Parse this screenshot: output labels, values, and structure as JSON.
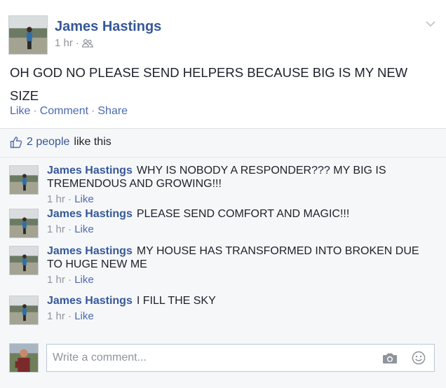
{
  "post": {
    "author": "James Hastings",
    "time": "1 hr",
    "audience_icon": "friends-icon",
    "text": "OH GOD NO PLEASE SEND HELPERS BECAUSE BIG IS MY NEW SIZE",
    "actions": {
      "like": "Like",
      "comment": "Comment",
      "share": "Share"
    }
  },
  "likes": {
    "count": "2 people",
    "suffix": "like this"
  },
  "comments": [
    {
      "author": "James Hastings",
      "text": "WHY IS NOBODY A RESPONDER??? MY BIG IS TREMENDOUS AND GROWING!!!",
      "time": "1 hr",
      "like": "Like"
    },
    {
      "author": "James Hastings",
      "text": "PLEASE SEND COMFORT AND MAGIC!!!",
      "time": "1 hr",
      "like": "Like"
    },
    {
      "author": "James Hastings",
      "text": "MY HOUSE HAS TRANSFORMED INTO BROKEN DUE TO HUGE NEW ME",
      "time": "1 hr",
      "like": "Like"
    },
    {
      "author": "James Hastings",
      "text": "I FILL THE SKY",
      "time": "1 hr",
      "like": "Like"
    }
  ],
  "composer": {
    "placeholder": "Write a comment..."
  },
  "colors": {
    "link": "#365899",
    "action": "#4b6ab0",
    "muted": "#90949c",
    "feedback_bg": "#f6f7f9"
  }
}
